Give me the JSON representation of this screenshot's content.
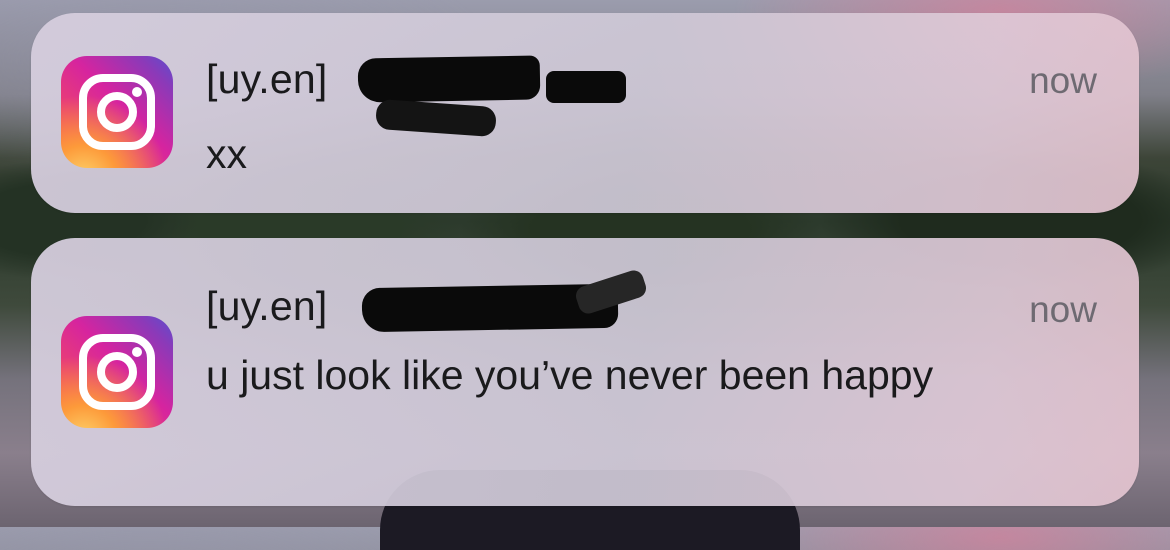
{
  "notifications": [
    {
      "app_icon": "instagram-icon",
      "sender": "[uy.en]",
      "time": "now",
      "message": "xx"
    },
    {
      "app_icon": "instagram-icon",
      "sender": "[uy.en]",
      "time": "now",
      "message": "u just look like you’ve never been happy"
    }
  ]
}
